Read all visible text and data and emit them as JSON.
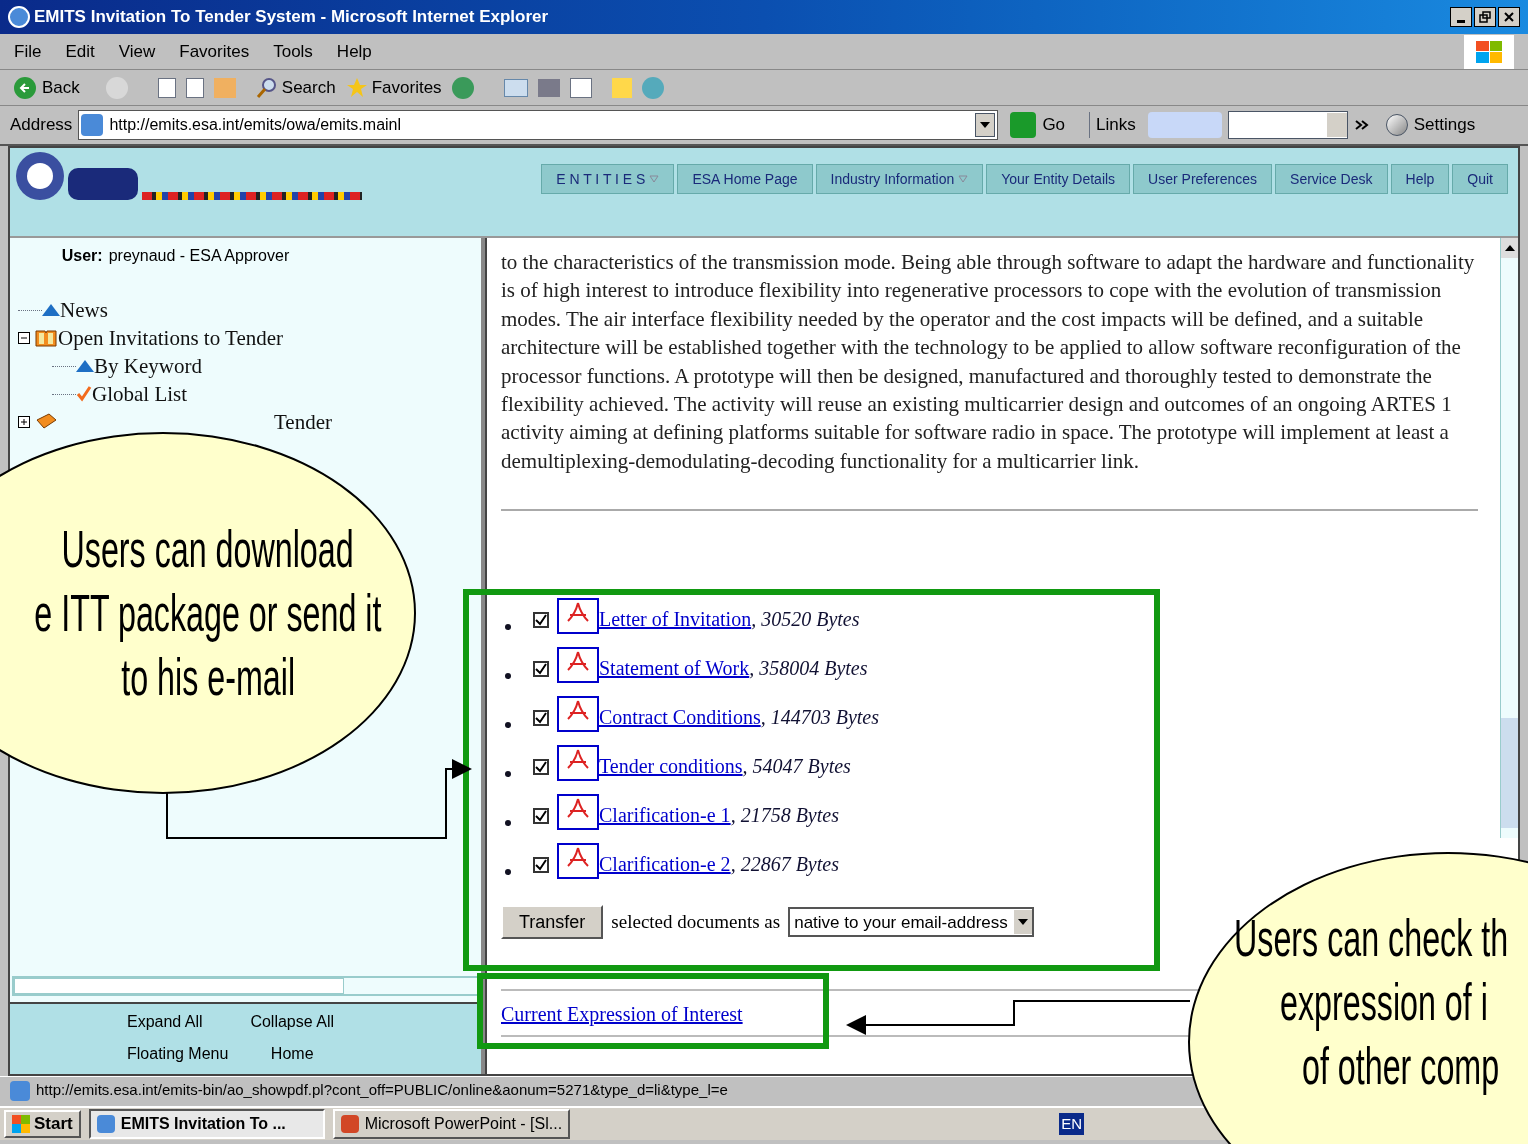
{
  "window": {
    "title": "EMITS Invitation To Tender System - Microsoft Internet Explorer"
  },
  "menu": [
    "File",
    "Edit",
    "View",
    "Favorites",
    "Tools",
    "Help"
  ],
  "toolbar": {
    "back": "Back",
    "search": "Search",
    "favorites": "Favorites"
  },
  "address": {
    "label": "Address",
    "url": "http://emits.esa.int/emits/owa/emits.mainl",
    "go": "Go",
    "links": "Links",
    "settings": "Settings"
  },
  "site_nav": [
    {
      "label": "E N T I T I E S",
      "dropdown": true
    },
    {
      "label": "ESA Home Page",
      "dropdown": false
    },
    {
      "label": "Industry Information",
      "dropdown": true
    },
    {
      "label": "Your Entity Details",
      "dropdown": false
    },
    {
      "label": "User Preferences",
      "dropdown": false
    },
    {
      "label": "Service Desk",
      "dropdown": false
    },
    {
      "label": "Help",
      "dropdown": false
    },
    {
      "label": "Quit",
      "dropdown": false
    }
  ],
  "user": {
    "label": "User:",
    "value": "preynaud - ESA Approver"
  },
  "tree": [
    {
      "label": "News",
      "kind": "leaf"
    },
    {
      "label": "Open Invitations to Tender",
      "kind": "folder",
      "expanded": true,
      "children": [
        {
          "label": "By Keyword",
          "kind": "leaf"
        },
        {
          "label": "Global List",
          "kind": "check"
        }
      ]
    },
    {
      "label": "Tender",
      "kind": "folder",
      "expanded": false
    }
  ],
  "tree_footer": [
    "Expand All",
    "Collapse All",
    "Floating Menu",
    "Home"
  ],
  "description": "to the characteristics of the transmission mode. Being able through software to adapt the hardware and functionality is of high interest to introduce flexibility into regenerative processors to cope with the evolution of transmission modes. The air interface flexibility needed by the operator and the cost impacts will be defined, and a suitable architecture will be established together with the technology to be applied to allow software reconfiguration of the processor functions. A prototype will then be designed, manufactured and thoroughly tested to demonstrate the flexibility achieved. The activity will reuse an existing multicarrier design and outcomes of an ongoing ARTES 1 activity aiming at defining platforms suitable for software radio in space. The prototype will implement at least a demultiplexing-demodulating-decoding functionality for a multicarrier link.",
  "documents": [
    {
      "name": "Letter of Invitation",
      "size": ", 30520 Bytes",
      "checked": true
    },
    {
      "name": "Statement of Work",
      "size": ", 358004 Bytes",
      "checked": true
    },
    {
      "name": "Contract Conditions",
      "size": ", 144703 Bytes",
      "checked": true
    },
    {
      "name": "Tender conditions",
      "size": ", 54047 Bytes",
      "checked": true
    },
    {
      "name": "Clarification-e 1",
      "size": ", 21758 Bytes",
      "checked": true
    },
    {
      "name": "Clarification-e 2",
      "size": ", 22867 Bytes",
      "checked": true
    }
  ],
  "transfer": {
    "button": "Transfer",
    "text": "selected documents as",
    "select": "native to your email-address"
  },
  "interest_link": "Current Expression of Interest",
  "status_bar": "http://emits.esa.int/emits-bin/ao_showpdf.pl?cont_off=PUBLIC/online&aonum=5271&type_d=li&type_l=e",
  "taskbar": {
    "start": "Start",
    "tasks": [
      {
        "label": "EMITS Invitation To ...",
        "selected": true
      },
      {
        "label": "Microsoft PowerPoint - [Sl...",
        "selected": false
      }
    ],
    "language": "EN"
  },
  "callouts": [
    {
      "lines": [
        "Users can download",
        "e ITT package or send it",
        "to his e-mail"
      ]
    },
    {
      "lines": [
        "Users can check th",
        "expression of i",
        "of other comp"
      ]
    }
  ]
}
